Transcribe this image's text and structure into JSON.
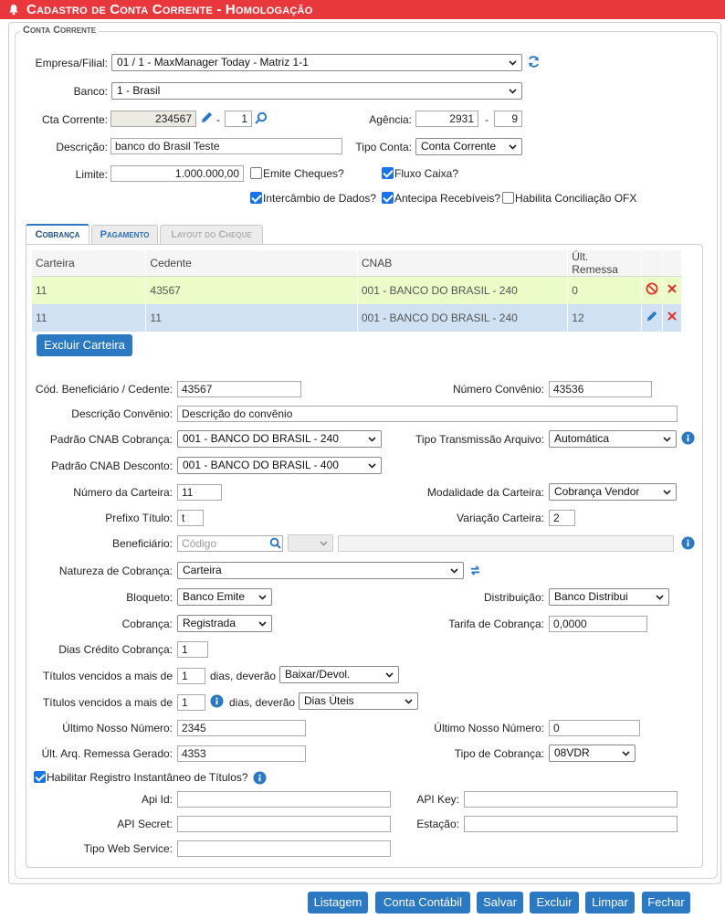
{
  "title": "Cadastro de Conta Corrente - Homologação",
  "legend": "Conta Corrente",
  "header": {
    "empresa_label": "Empresa/Filial:",
    "empresa_value": "01 / 1 - MaxManager Today - Matriz 1-1",
    "banco_label": "Banco:",
    "banco_value": "1 - Brasil",
    "cta_label": "Cta Corrente:",
    "cta_value": "234567",
    "cta_sep": "-",
    "cta_dig": "1",
    "agencia_label": "Agência:",
    "agencia_value": "2931",
    "agencia_sep": "-",
    "agencia_dig": "9",
    "descricao_label": "Descrição:",
    "descricao_value": "banco do Brasil Teste",
    "tipo_conta_label": "Tipo Conta:",
    "tipo_conta_value": "Conta Corrente",
    "limite_label": "Limite:",
    "limite_value": "1.000.000,00",
    "emite_cheques": "Emite Cheques?",
    "fluxo_caixa": "Fluxo Caixa?",
    "intercambio": "Intercâmbio de Dados?",
    "antecipa": "Antecipa Recebíveis?",
    "habilita_ofx": "Habilita Conciliação OFX"
  },
  "tabs": [
    {
      "label": "Cobrança"
    },
    {
      "label": "Pagamento"
    },
    {
      "label": "Layout do Cheque"
    }
  ],
  "grid": {
    "headers": [
      "Carteira",
      "Cedente",
      "CNAB",
      "Últ. Remessa"
    ],
    "rows": [
      [
        "11",
        "43567",
        "001 - BANCO DO BRASIL - 240",
        "0"
      ],
      [
        "11",
        "11",
        "001 - BANCO DO BRASIL - 240",
        "12"
      ]
    ]
  },
  "excluir_carteira": "Excluir Carteira",
  "form": {
    "cod_benef_label": "Cód. Beneficiário / Cedente:",
    "cod_benef_value": "43567",
    "num_convenio_label": "Número Convênio:",
    "num_convenio_value": "43536",
    "desc_convenio_label": "Descrição Convênio:",
    "desc_convenio_value": "Descrição do convênio",
    "padrao_cob_label": "Padrão CNAB Cobrança:",
    "padrao_cob_value": "001 - BANCO DO BRASIL - 240",
    "tipo_trans_label": "Tipo Transmissão Arquivo:",
    "tipo_trans_value": "Automática",
    "padrao_desc_label": "Padrão CNAB Desconto:",
    "padrao_desc_value": "001 - BANCO DO BRASIL - 400",
    "num_carteira_label": "Número da Carteira:",
    "num_carteira_value": "11",
    "modalidade_label": "Modalidade da Carteira:",
    "modalidade_value": "Cobrança Vendor",
    "prefixo_label": "Prefixo Título:",
    "prefixo_value": "t",
    "variacao_label": "Variação Carteira:",
    "variacao_value": "2",
    "beneficiario_label": "Beneficiário:",
    "beneficiario_placeholder": "Código",
    "natureza_label": "Natureza de Cobrança:",
    "natureza_value": "Carteira",
    "bloqueto_label": "Bloqueto:",
    "bloqueto_value": "Banco Emite",
    "distribuicao_label": "Distribuição:",
    "distribuicao_value": "Banco Distribui",
    "cobranca_label": "Cobrança:",
    "cobranca_value": "Registrada",
    "tarifa_label": "Tarifa de Cobrança:",
    "tarifa_value": "0,0000",
    "dias_credito_label": "Dias Crédito Cobrança:",
    "dias_credito_value": "1",
    "tit_venc_label": "Títulos vencidos a mais de",
    "tit_venc1_value": "1",
    "dias_deverao": "dias, deverão",
    "acao1_value": "Baixar/Devol.",
    "tit_venc2_value": "1",
    "acao2_value": "Dias Úteis",
    "ultimo_nn_label": "Último Nosso Número:",
    "ultimo_nn_value": "2345",
    "ultimo_nn2_label": "Último Nosso Número:",
    "ultimo_nn2_value": "0",
    "ult_arq_label": "Últ. Arq. Remessa Gerado:",
    "ult_arq_value": "4353",
    "tipo_cob_label": "Tipo de Cobrança:",
    "tipo_cob_value": "08VDR",
    "habilitar_registro": "Habilitar Registro Instantâneo de Títulos?",
    "api_id_label": "Api Id:",
    "api_key_label": "API Key:",
    "api_secret_label": "API Secret:",
    "estacao_label": "Estação:",
    "tipo_ws_label": "Tipo Web Service:"
  },
  "buttons": [
    "Listagem",
    "Conta Contábil",
    "Salvar",
    "Excluir",
    "Limpar",
    "Fechar"
  ],
  "colors": {
    "title_bar": "#e8383d",
    "button": "#2b79c2",
    "row_highlight": "#ecfcc8",
    "row_selected": "#cfe1f3"
  }
}
